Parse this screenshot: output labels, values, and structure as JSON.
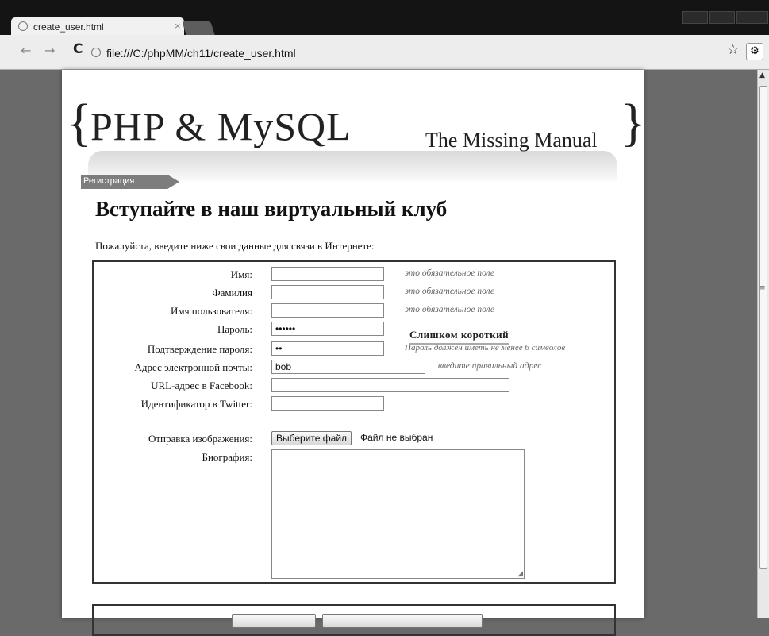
{
  "browser": {
    "tab_title": "create_user.html",
    "tab_close": "×",
    "url": "file:///C:/phpMM/ch11/create_user.html",
    "back": "←",
    "forward": "→",
    "reload": "C",
    "bookmark_star": "☆",
    "wrench": "🔧"
  },
  "header": {
    "brace_open": "{",
    "title": "PHP & MySQL",
    "subtitle": "The Missing Manual",
    "brace_close": "}"
  },
  "breadcrumb": "Регистрация",
  "page": {
    "heading": "Вступайте в наш виртуальный клуб",
    "intro": "Пожалуйста, введите ниже свои данные для связи в Интернете:"
  },
  "form": {
    "first_name": {
      "label": "Имя:",
      "value": "",
      "hint": "это обязательное поле"
    },
    "last_name": {
      "label": "Фамилия",
      "value": "",
      "hint": "это обязательное поле"
    },
    "username": {
      "label": "Имя пользователя:",
      "value": "",
      "hint": "это обязательное поле"
    },
    "password": {
      "label": "Пароль:",
      "value": "••••••",
      "strength": "Слишком короткий"
    },
    "password_confirm": {
      "label": "Подтверждение пароля:",
      "value": "••",
      "hint": "Пароль должен иметь не менее 6 символов"
    },
    "email": {
      "label": "Адрес электронной почты:",
      "value": "bob",
      "hint": "введите правильный адрес"
    },
    "facebook": {
      "label": "URL-адрес в Facebook:",
      "value": ""
    },
    "twitter": {
      "label": "Идентификатор в Twitter:",
      "value": ""
    },
    "image": {
      "label": "Отправка изображения:",
      "button": "Выберите файл",
      "status": "Файл не выбран"
    },
    "bio": {
      "label": "Биография:",
      "value": ""
    }
  }
}
